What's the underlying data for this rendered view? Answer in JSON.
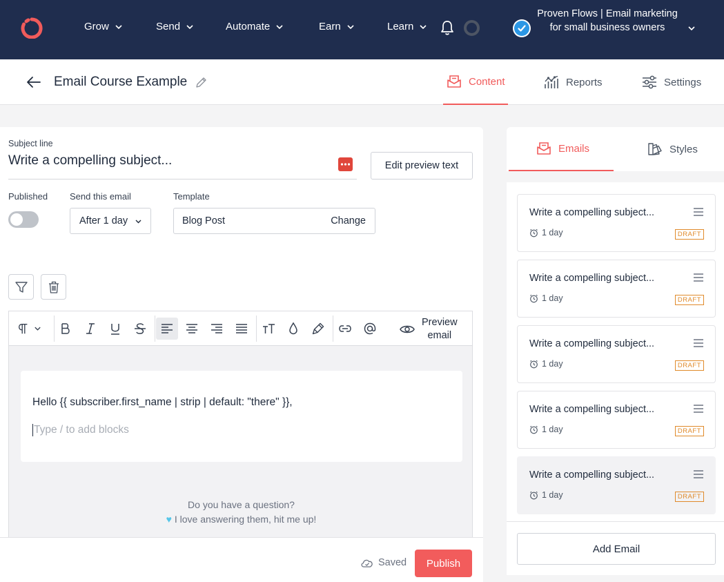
{
  "nav": {
    "items": [
      "Grow",
      "Send",
      "Automate",
      "Earn",
      "Learn"
    ],
    "account_name": "Proven Flows | Email marketing for small business owners"
  },
  "header": {
    "back_icon": "arrow-left-icon",
    "title": "Email Course Example",
    "tabs": [
      {
        "label": "Content",
        "icon": "envelope-icon",
        "active": true
      },
      {
        "label": "Reports",
        "icon": "chart-icon",
        "active": false
      },
      {
        "label": "Settings",
        "icon": "sliders-icon",
        "active": false
      }
    ]
  },
  "editor": {
    "subject_label": "Subject line",
    "subject_value": "Write a compelling subject...",
    "edit_preview_label": "Edit preview text",
    "published_label": "Published",
    "published_on": false,
    "send_label": "Send this email",
    "send_value": "After 1 day",
    "template_label": "Template",
    "template_value": "Blog Post",
    "template_change": "Change",
    "preview_label_1": "Preview",
    "preview_label_2": "email",
    "greeting": "Hello {{ subscriber.first_name | strip | default: \"there\" }},",
    "placeholder": "Type / to add blocks",
    "question_1": "Do you have a question?",
    "question_2": "I love answering them, hit me up!",
    "saved_label": "Saved",
    "publish_label": "Publish"
  },
  "sidebar": {
    "tabs": [
      {
        "label": "Emails",
        "active": true
      },
      {
        "label": "Styles",
        "active": false
      }
    ],
    "emails": [
      {
        "title": "Write a compelling subject...",
        "delay": "1 day",
        "status": "DRAFT"
      },
      {
        "title": "Write a compelling subject...",
        "delay": "1 day",
        "status": "DRAFT"
      },
      {
        "title": "Write a compelling subject...",
        "delay": "1 day",
        "status": "DRAFT"
      },
      {
        "title": "Write a compelling subject...",
        "delay": "1 day",
        "status": "DRAFT"
      },
      {
        "title": "Write a compelling subject...",
        "delay": "1 day",
        "status": "DRAFT"
      }
    ],
    "add_email_label": "Add Email"
  },
  "colors": {
    "nav_bg": "#1f2d4e",
    "accent": "#f15b5b",
    "draft": "#e08a2a"
  }
}
